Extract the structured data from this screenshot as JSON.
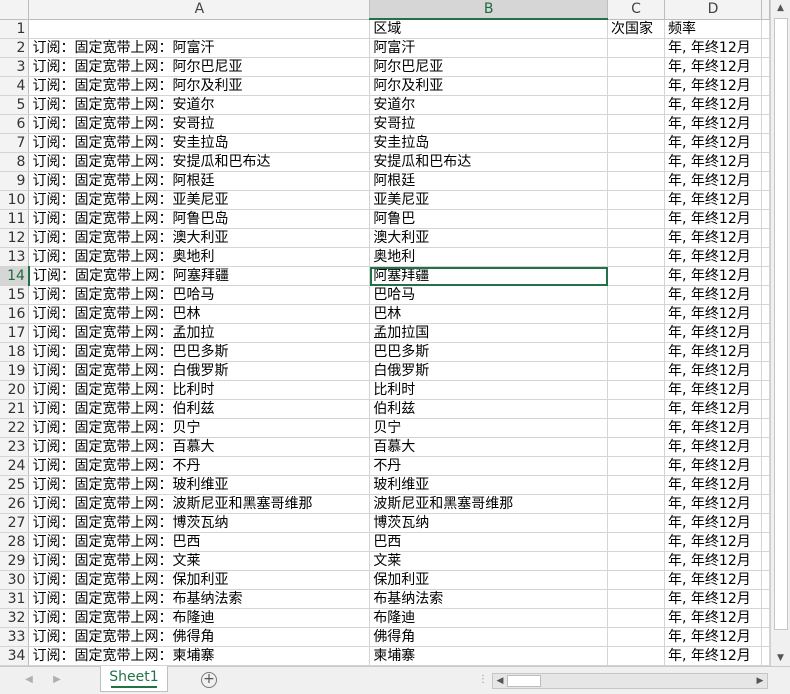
{
  "columns": {
    "letters": [
      "A",
      "B",
      "C",
      "D"
    ]
  },
  "rows": [
    {
      "n": "1",
      "a": "",
      "b": "区域",
      "c": "次国家",
      "d": "频率"
    },
    {
      "n": "2",
      "a": "订阅：固定宽带上网：阿富汗",
      "b": "阿富汗",
      "c": "",
      "d": "年, 年终12月"
    },
    {
      "n": "3",
      "a": "订阅：固定宽带上网：阿尔巴尼亚",
      "b": "阿尔巴尼亚",
      "c": "",
      "d": "年, 年终12月"
    },
    {
      "n": "4",
      "a": "订阅：固定宽带上网：阿尔及利亚",
      "b": "阿尔及利亚",
      "c": "",
      "d": "年, 年终12月"
    },
    {
      "n": "5",
      "a": "订阅：固定宽带上网：安道尔",
      "b": "安道尔",
      "c": "",
      "d": "年, 年终12月"
    },
    {
      "n": "6",
      "a": "订阅：固定宽带上网：安哥拉",
      "b": "安哥拉",
      "c": "",
      "d": "年, 年终12月"
    },
    {
      "n": "7",
      "a": "订阅：固定宽带上网：安圭拉岛",
      "b": "安圭拉岛",
      "c": "",
      "d": "年, 年终12月"
    },
    {
      "n": "8",
      "a": "订阅：固定宽带上网：安提瓜和巴布达",
      "b": "安提瓜和巴布达",
      "c": "",
      "d": "年, 年终12月"
    },
    {
      "n": "9",
      "a": "订阅：固定宽带上网：阿根廷",
      "b": "阿根廷",
      "c": "",
      "d": "年, 年终12月"
    },
    {
      "n": "10",
      "a": "订阅：固定宽带上网：亚美尼亚",
      "b": "亚美尼亚",
      "c": "",
      "d": "年, 年终12月"
    },
    {
      "n": "11",
      "a": "订阅：固定宽带上网：阿鲁巴岛",
      "b": "阿鲁巴",
      "c": "",
      "d": "年, 年终12月"
    },
    {
      "n": "12",
      "a": "订阅：固定宽带上网：澳大利亚",
      "b": "澳大利亚",
      "c": "",
      "d": "年, 年终12月"
    },
    {
      "n": "13",
      "a": "订阅：固定宽带上网：奥地利",
      "b": "奥地利",
      "c": "",
      "d": "年, 年终12月"
    },
    {
      "n": "14",
      "a": "订阅：固定宽带上网：阿塞拜疆",
      "b": "阿塞拜疆",
      "c": "",
      "d": "年, 年终12月"
    },
    {
      "n": "15",
      "a": "订阅：固定宽带上网：巴哈马",
      "b": "巴哈马",
      "c": "",
      "d": "年, 年终12月"
    },
    {
      "n": "16",
      "a": "订阅：固定宽带上网：巴林",
      "b": "巴林",
      "c": "",
      "d": "年, 年终12月"
    },
    {
      "n": "17",
      "a": "订阅：固定宽带上网：孟加拉",
      "b": "孟加拉国",
      "c": "",
      "d": "年, 年终12月"
    },
    {
      "n": "18",
      "a": "订阅：固定宽带上网：巴巴多斯",
      "b": "巴巴多斯",
      "c": "",
      "d": "年, 年终12月"
    },
    {
      "n": "19",
      "a": "订阅：固定宽带上网：白俄罗斯",
      "b": "白俄罗斯",
      "c": "",
      "d": "年, 年终12月"
    },
    {
      "n": "20",
      "a": "订阅：固定宽带上网：比利时",
      "b": "比利时",
      "c": "",
      "d": "年, 年终12月"
    },
    {
      "n": "21",
      "a": "订阅：固定宽带上网：伯利兹",
      "b": "伯利兹",
      "c": "",
      "d": "年, 年终12月"
    },
    {
      "n": "22",
      "a": "订阅：固定宽带上网：贝宁",
      "b": "贝宁",
      "c": "",
      "d": "年, 年终12月"
    },
    {
      "n": "23",
      "a": "订阅：固定宽带上网：百慕大",
      "b": "百慕大",
      "c": "",
      "d": "年, 年终12月"
    },
    {
      "n": "24",
      "a": "订阅：固定宽带上网：不丹",
      "b": "不丹",
      "c": "",
      "d": "年, 年终12月"
    },
    {
      "n": "25",
      "a": "订阅：固定宽带上网：玻利维亚",
      "b": "玻利维亚",
      "c": "",
      "d": "年, 年终12月"
    },
    {
      "n": "26",
      "a": "订阅：固定宽带上网：波斯尼亚和黑塞哥维那",
      "b": "波斯尼亚和黑塞哥维那",
      "c": "",
      "d": "年, 年终12月"
    },
    {
      "n": "27",
      "a": "订阅：固定宽带上网：博茨瓦纳",
      "b": "博茨瓦纳",
      "c": "",
      "d": "年, 年终12月"
    },
    {
      "n": "28",
      "a": "订阅：固定宽带上网：巴西",
      "b": "巴西",
      "c": "",
      "d": "年, 年终12月"
    },
    {
      "n": "29",
      "a": "订阅：固定宽带上网：文莱",
      "b": "文莱",
      "c": "",
      "d": "年, 年终12月"
    },
    {
      "n": "30",
      "a": "订阅：固定宽带上网：保加利亚",
      "b": "保加利亚",
      "c": "",
      "d": "年, 年终12月"
    },
    {
      "n": "31",
      "a": "订阅：固定宽带上网：布基纳法索",
      "b": "布基纳法索",
      "c": "",
      "d": "年, 年终12月"
    },
    {
      "n": "32",
      "a": "订阅：固定宽带上网：布隆迪",
      "b": "布隆迪",
      "c": "",
      "d": "年, 年终12月"
    },
    {
      "n": "33",
      "a": "订阅：固定宽带上网：佛得角",
      "b": "佛得角",
      "c": "",
      "d": "年, 年终12月"
    },
    {
      "n": "34",
      "a": "订阅：固定宽带上网：柬埔寨",
      "b": "柬埔寨",
      "c": "",
      "d": "年, 年终12月"
    }
  ],
  "active_row": "14",
  "sheet_tab": {
    "label": "Sheet1"
  },
  "icons": {
    "add_sheet": "plus-circle-icon",
    "scroll_up": "triangle-up-icon",
    "scroll_down": "triangle-down-icon",
    "scroll_left": "triangle-left-icon",
    "scroll_right": "triangle-right-icon"
  },
  "colors": {
    "accent": "#217346"
  }
}
